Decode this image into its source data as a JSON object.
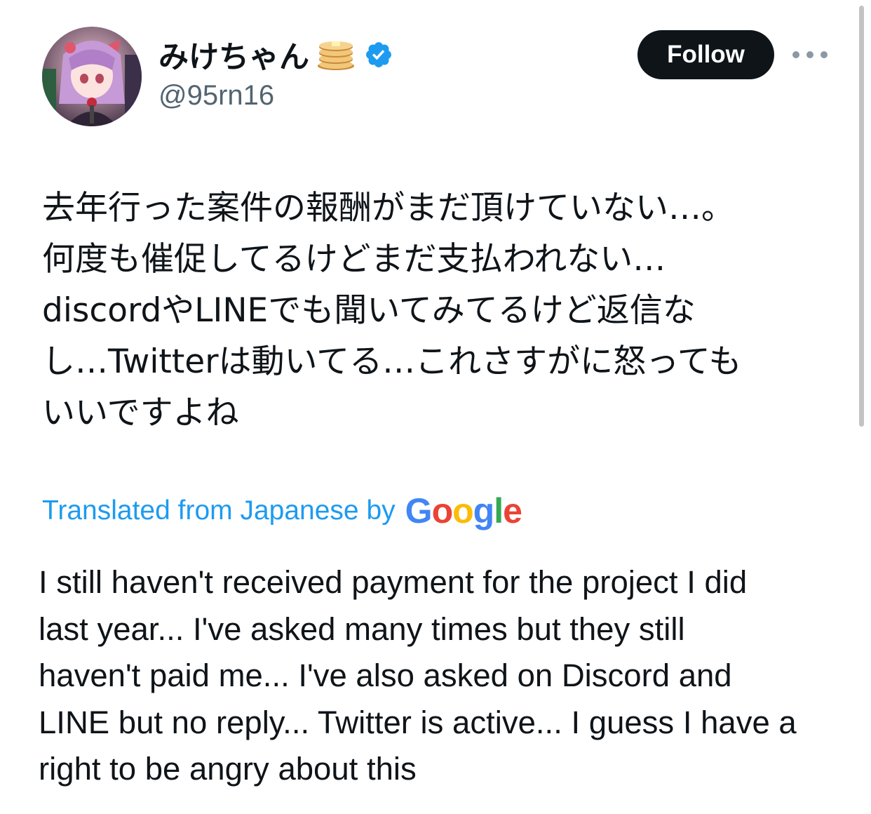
{
  "author": {
    "display_name": "みけちゃん",
    "handle": "@95rn16",
    "verified": true,
    "avatar_icon": "avatar-image",
    "emoji_icon": "pancakes-icon"
  },
  "actions": {
    "follow_label": "Follow",
    "more_icon": "more-options-icon"
  },
  "tweet": {
    "text_lines": [
      "去年行った案件の報酬がまだ頂けていない…。",
      "何度も催促してるけどまだ支払われない…",
      "discordやLINEでも聞いてみてるけど返信な",
      "し…Twitterは動いてる…これさすがに怒っても",
      "いいですよね"
    ]
  },
  "translation": {
    "label": "Translated from Japanese by",
    "provider": "Google",
    "text_lines": [
      "I still haven't received payment for the project I did",
      "last year... I've asked many times but they still",
      "haven't paid me... I've also asked on Discord and",
      "LINE but no reply... Twitter is active... I guess I have a",
      "right to be angry about this"
    ]
  },
  "colors": {
    "link_blue": "#1d9bf0",
    "verified_blue": "#1d9bf0",
    "text_primary": "#0f1419",
    "text_secondary": "#536471",
    "follow_bg": "#0f1419",
    "google_blue": "#4285F4",
    "google_red": "#EA4335",
    "google_yellow": "#FBBC05",
    "google_green": "#34A853"
  }
}
